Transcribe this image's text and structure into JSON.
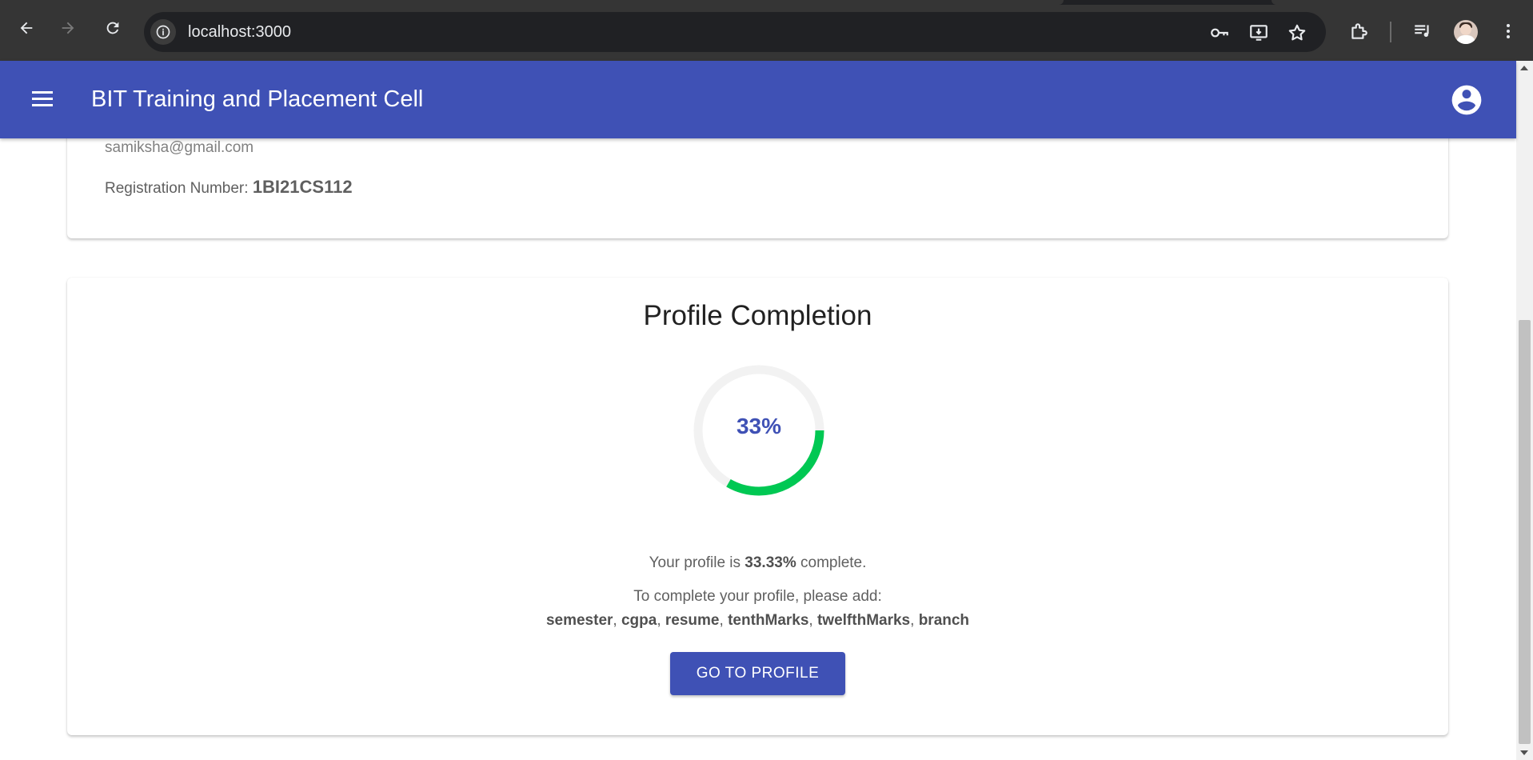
{
  "browser": {
    "url": "localhost:3000",
    "icons": [
      "back-arrow-icon",
      "forward-arrow-icon",
      "reload-icon",
      "site-info-icon",
      "password-key-icon",
      "install-app-icon",
      "bookmark-star-icon",
      "extensions-puzzle-icon",
      "media-queue-icon",
      "profile-avatar",
      "kebab-menu-icon"
    ]
  },
  "header": {
    "title": "BIT Training and Placement Cell",
    "color": "#3f51b5"
  },
  "profile_card": {
    "email": "samiksha@gmail.com",
    "registration_label": "Registration Number:",
    "registration_value": "1BI21CS112"
  },
  "completion": {
    "title": "Profile Completion",
    "percent_label": "33%",
    "progress": 0.3333,
    "ring_color": "#00c853",
    "status_prefix": "Your profile is",
    "status_value": "33.33%",
    "status_suffix": "complete.",
    "todo_text": "To complete your profile, please add:",
    "missing_fields": [
      "semester",
      "cgpa",
      "resume",
      "tenthMarks",
      "twelfthMarks",
      "branch"
    ],
    "button_label": "GO TO PROFILE"
  }
}
